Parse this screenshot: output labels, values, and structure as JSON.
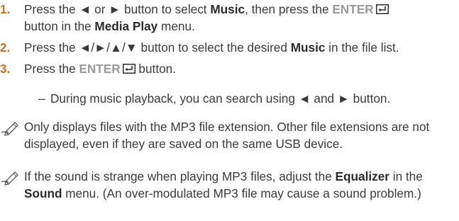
{
  "steps": [
    {
      "number": "1.",
      "t1": "Press the ◄ or ► button to select ",
      "b1": "Music",
      "t2": ", then press the ",
      "enter": "ENTER",
      "t3": "button in the ",
      "b2": "Media Play",
      "t4": " menu."
    },
    {
      "number": "2.",
      "t1": "Press the ◄/►/▲/▼ button to select the desired ",
      "b1": "Music",
      "t2": " in the file list."
    },
    {
      "number": "3.",
      "t1": "Press the ",
      "enter": "ENTER",
      "t2": " button."
    }
  ],
  "sub_note": {
    "dash": "–",
    "text": "During music playback, you can search using ◄ and ► button."
  },
  "notes": [
    {
      "text": "Only displays files with the MP3 file extension. Other file extensions are not displayed, even if they are saved on the same USB device."
    },
    {
      "t1": "If the sound is strange when playing MP3 files, adjust the ",
      "b1": "Equalizer",
      "t2": " in the ",
      "b2": "Sound",
      "t3": " menu. (An over-modulated MP3 file may cause a sound problem.)"
    }
  ],
  "icons": {
    "enter": "enter-return-icon",
    "note": "note-pencil-icon"
  },
  "colors": {
    "step_number": "#c9731a",
    "text": "#3a3a3a",
    "enter_label": "#9a9a9a"
  }
}
